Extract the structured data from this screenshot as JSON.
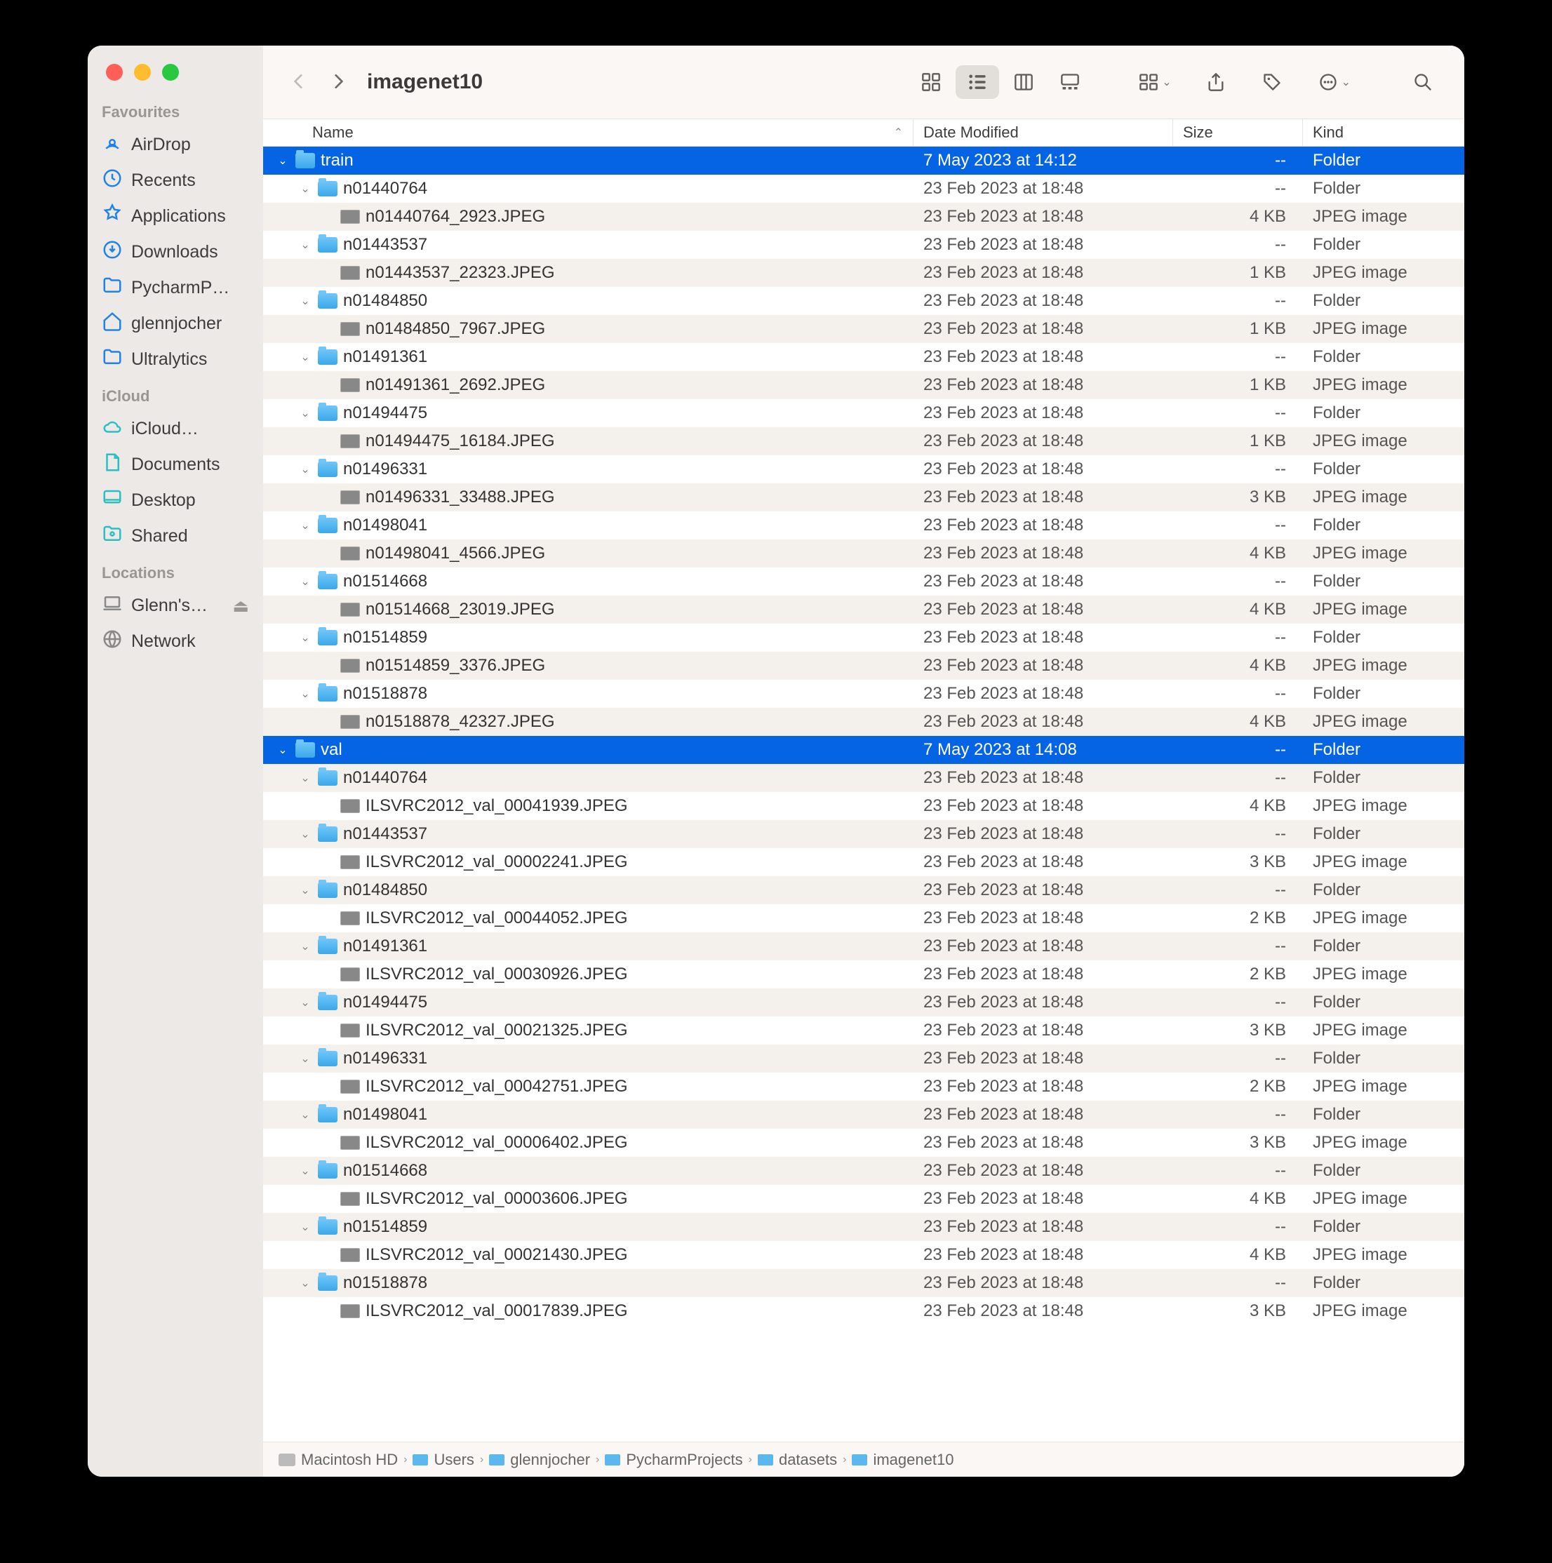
{
  "title": "imagenet10",
  "columns": {
    "name": "Name",
    "date": "Date Modified",
    "size": "Size",
    "kind": "Kind"
  },
  "sidebar": {
    "sections": [
      {
        "label": "Favourites",
        "items": [
          {
            "label": "AirDrop",
            "icon": "airdrop"
          },
          {
            "label": "Recents",
            "icon": "clock"
          },
          {
            "label": "Applications",
            "icon": "apps"
          },
          {
            "label": "Downloads",
            "icon": "download"
          },
          {
            "label": "PycharmP…",
            "icon": "folder"
          },
          {
            "label": "glennjocher",
            "icon": "home"
          },
          {
            "label": "Ultralytics",
            "icon": "folder"
          }
        ]
      },
      {
        "label": "iCloud",
        "items": [
          {
            "label": "iCloud…",
            "icon": "cloud"
          },
          {
            "label": "Documents",
            "icon": "doc"
          },
          {
            "label": "Desktop",
            "icon": "desktop"
          },
          {
            "label": "Shared",
            "icon": "shared"
          }
        ]
      },
      {
        "label": "Locations",
        "items": [
          {
            "label": "Glenn's…",
            "icon": "laptop",
            "eject": true
          },
          {
            "label": "Network",
            "icon": "globe"
          }
        ]
      }
    ]
  },
  "rows": [
    {
      "depth": 0,
      "expanded": true,
      "type": "folder",
      "name": "train",
      "date": "7 May 2023 at 14:12",
      "size": "--",
      "kind": "Folder",
      "selected": true
    },
    {
      "depth": 1,
      "expanded": true,
      "type": "folder",
      "name": "n01440764",
      "date": "23 Feb 2023 at 18:48",
      "size": "--",
      "kind": "Folder"
    },
    {
      "depth": 2,
      "type": "image",
      "name": "n01440764_2923.JPEG",
      "date": "23 Feb 2023 at 18:48",
      "size": "4 KB",
      "kind": "JPEG image"
    },
    {
      "depth": 1,
      "expanded": true,
      "type": "folder",
      "name": "n01443537",
      "date": "23 Feb 2023 at 18:48",
      "size": "--",
      "kind": "Folder"
    },
    {
      "depth": 2,
      "type": "image",
      "name": "n01443537_22323.JPEG",
      "date": "23 Feb 2023 at 18:48",
      "size": "1 KB",
      "kind": "JPEG image"
    },
    {
      "depth": 1,
      "expanded": true,
      "type": "folder",
      "name": "n01484850",
      "date": "23 Feb 2023 at 18:48",
      "size": "--",
      "kind": "Folder"
    },
    {
      "depth": 2,
      "type": "image",
      "name": "n01484850_7967.JPEG",
      "date": "23 Feb 2023 at 18:48",
      "size": "1 KB",
      "kind": "JPEG image"
    },
    {
      "depth": 1,
      "expanded": true,
      "type": "folder",
      "name": "n01491361",
      "date": "23 Feb 2023 at 18:48",
      "size": "--",
      "kind": "Folder"
    },
    {
      "depth": 2,
      "type": "image",
      "name": "n01491361_2692.JPEG",
      "date": "23 Feb 2023 at 18:48",
      "size": "1 KB",
      "kind": "JPEG image"
    },
    {
      "depth": 1,
      "expanded": true,
      "type": "folder",
      "name": "n01494475",
      "date": "23 Feb 2023 at 18:48",
      "size": "--",
      "kind": "Folder"
    },
    {
      "depth": 2,
      "type": "image",
      "name": "n01494475_16184.JPEG",
      "date": "23 Feb 2023 at 18:48",
      "size": "1 KB",
      "kind": "JPEG image"
    },
    {
      "depth": 1,
      "expanded": true,
      "type": "folder",
      "name": "n01496331",
      "date": "23 Feb 2023 at 18:48",
      "size": "--",
      "kind": "Folder"
    },
    {
      "depth": 2,
      "type": "image",
      "name": "n01496331_33488.JPEG",
      "date": "23 Feb 2023 at 18:48",
      "size": "3 KB",
      "kind": "JPEG image"
    },
    {
      "depth": 1,
      "expanded": true,
      "type": "folder",
      "name": "n01498041",
      "date": "23 Feb 2023 at 18:48",
      "size": "--",
      "kind": "Folder"
    },
    {
      "depth": 2,
      "type": "image",
      "name": "n01498041_4566.JPEG",
      "date": "23 Feb 2023 at 18:48",
      "size": "4 KB",
      "kind": "JPEG image"
    },
    {
      "depth": 1,
      "expanded": true,
      "type": "folder",
      "name": "n01514668",
      "date": "23 Feb 2023 at 18:48",
      "size": "--",
      "kind": "Folder"
    },
    {
      "depth": 2,
      "type": "image",
      "name": "n01514668_23019.JPEG",
      "date": "23 Feb 2023 at 18:48",
      "size": "4 KB",
      "kind": "JPEG image"
    },
    {
      "depth": 1,
      "expanded": true,
      "type": "folder",
      "name": "n01514859",
      "date": "23 Feb 2023 at 18:48",
      "size": "--",
      "kind": "Folder"
    },
    {
      "depth": 2,
      "type": "image",
      "name": "n01514859_3376.JPEG",
      "date": "23 Feb 2023 at 18:48",
      "size": "4 KB",
      "kind": "JPEG image"
    },
    {
      "depth": 1,
      "expanded": true,
      "type": "folder",
      "name": "n01518878",
      "date": "23 Feb 2023 at 18:48",
      "size": "--",
      "kind": "Folder"
    },
    {
      "depth": 2,
      "type": "image",
      "name": "n01518878_42327.JPEG",
      "date": "23 Feb 2023 at 18:48",
      "size": "4 KB",
      "kind": "JPEG image"
    },
    {
      "depth": 0,
      "expanded": true,
      "type": "folder",
      "name": "val",
      "date": "7 May 2023 at 14:08",
      "size": "--",
      "kind": "Folder",
      "selected": true
    },
    {
      "depth": 1,
      "expanded": true,
      "type": "folder",
      "name": "n01440764",
      "date": "23 Feb 2023 at 18:48",
      "size": "--",
      "kind": "Folder"
    },
    {
      "depth": 2,
      "type": "image",
      "name": "ILSVRC2012_val_00041939.JPEG",
      "date": "23 Feb 2023 at 18:48",
      "size": "4 KB",
      "kind": "JPEG image"
    },
    {
      "depth": 1,
      "expanded": true,
      "type": "folder",
      "name": "n01443537",
      "date": "23 Feb 2023 at 18:48",
      "size": "--",
      "kind": "Folder"
    },
    {
      "depth": 2,
      "type": "image",
      "name": "ILSVRC2012_val_00002241.JPEG",
      "date": "23 Feb 2023 at 18:48",
      "size": "3 KB",
      "kind": "JPEG image"
    },
    {
      "depth": 1,
      "expanded": true,
      "type": "folder",
      "name": "n01484850",
      "date": "23 Feb 2023 at 18:48",
      "size": "--",
      "kind": "Folder"
    },
    {
      "depth": 2,
      "type": "image",
      "name": "ILSVRC2012_val_00044052.JPEG",
      "date": "23 Feb 2023 at 18:48",
      "size": "2 KB",
      "kind": "JPEG image"
    },
    {
      "depth": 1,
      "expanded": true,
      "type": "folder",
      "name": "n01491361",
      "date": "23 Feb 2023 at 18:48",
      "size": "--",
      "kind": "Folder"
    },
    {
      "depth": 2,
      "type": "image",
      "name": "ILSVRC2012_val_00030926.JPEG",
      "date": "23 Feb 2023 at 18:48",
      "size": "2 KB",
      "kind": "JPEG image"
    },
    {
      "depth": 1,
      "expanded": true,
      "type": "folder",
      "name": "n01494475",
      "date": "23 Feb 2023 at 18:48",
      "size": "--",
      "kind": "Folder"
    },
    {
      "depth": 2,
      "type": "image",
      "name": "ILSVRC2012_val_00021325.JPEG",
      "date": "23 Feb 2023 at 18:48",
      "size": "3 KB",
      "kind": "JPEG image"
    },
    {
      "depth": 1,
      "expanded": true,
      "type": "folder",
      "name": "n01496331",
      "date": "23 Feb 2023 at 18:48",
      "size": "--",
      "kind": "Folder"
    },
    {
      "depth": 2,
      "type": "image",
      "name": "ILSVRC2012_val_00042751.JPEG",
      "date": "23 Feb 2023 at 18:48",
      "size": "2 KB",
      "kind": "JPEG image"
    },
    {
      "depth": 1,
      "expanded": true,
      "type": "folder",
      "name": "n01498041",
      "date": "23 Feb 2023 at 18:48",
      "size": "--",
      "kind": "Folder"
    },
    {
      "depth": 2,
      "type": "image",
      "name": "ILSVRC2012_val_00006402.JPEG",
      "date": "23 Feb 2023 at 18:48",
      "size": "3 KB",
      "kind": "JPEG image"
    },
    {
      "depth": 1,
      "expanded": true,
      "type": "folder",
      "name": "n01514668",
      "date": "23 Feb 2023 at 18:48",
      "size": "--",
      "kind": "Folder"
    },
    {
      "depth": 2,
      "type": "image",
      "name": "ILSVRC2012_val_00003606.JPEG",
      "date": "23 Feb 2023 at 18:48",
      "size": "4 KB",
      "kind": "JPEG image"
    },
    {
      "depth": 1,
      "expanded": true,
      "type": "folder",
      "name": "n01514859",
      "date": "23 Feb 2023 at 18:48",
      "size": "--",
      "kind": "Folder"
    },
    {
      "depth": 2,
      "type": "image",
      "name": "ILSVRC2012_val_00021430.JPEG",
      "date": "23 Feb 2023 at 18:48",
      "size": "4 KB",
      "kind": "JPEG image"
    },
    {
      "depth": 1,
      "expanded": true,
      "type": "folder",
      "name": "n01518878",
      "date": "23 Feb 2023 at 18:48",
      "size": "--",
      "kind": "Folder"
    },
    {
      "depth": 2,
      "type": "image",
      "name": "ILSVRC2012_val_00017839.JPEG",
      "date": "23 Feb 2023 at 18:48",
      "size": "3 KB",
      "kind": "JPEG image"
    }
  ],
  "path": [
    "Macintosh HD",
    "Users",
    "glennjocher",
    "PycharmProjects",
    "datasets",
    "imagenet10"
  ]
}
